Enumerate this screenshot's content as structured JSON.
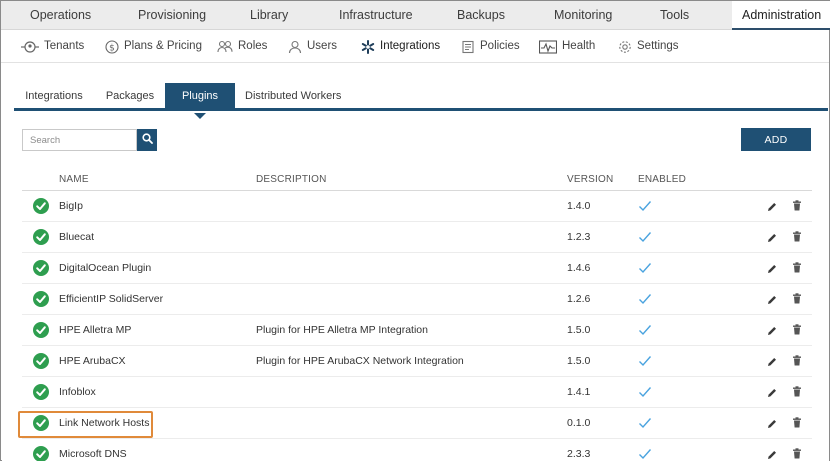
{
  "topnav": {
    "items": [
      {
        "label": "Operations"
      },
      {
        "label": "Provisioning"
      },
      {
        "label": "Library"
      },
      {
        "label": "Infrastructure"
      },
      {
        "label": "Backups"
      },
      {
        "label": "Monitoring"
      },
      {
        "label": "Tools"
      },
      {
        "label": "Administration",
        "active": true
      }
    ]
  },
  "subnav": {
    "items": [
      {
        "label": "Tenants",
        "icon": "tenants-icon"
      },
      {
        "label": "Plans & Pricing",
        "icon": "dollar-icon"
      },
      {
        "label": "Roles",
        "icon": "roles-icon"
      },
      {
        "label": "Users",
        "icon": "user-icon"
      },
      {
        "label": "Integrations",
        "icon": "integrations-icon",
        "active": true
      },
      {
        "label": "Policies",
        "icon": "policies-icon"
      },
      {
        "label": "Health",
        "icon": "health-icon"
      },
      {
        "label": "Settings",
        "icon": "gear-icon"
      }
    ]
  },
  "tabs": [
    {
      "label": "Integrations"
    },
    {
      "label": "Packages"
    },
    {
      "label": "Plugins",
      "active": true
    },
    {
      "label": "Distributed Workers"
    }
  ],
  "search": {
    "placeholder": "Search",
    "value": ""
  },
  "add_label": "ADD",
  "table": {
    "headers": {
      "name": "NAME",
      "description": "DESCRIPTION",
      "version": "VERSION",
      "enabled": "ENABLED"
    },
    "rows": [
      {
        "name": "BigIp",
        "description": "",
        "version": "1.4.0",
        "enabled": true
      },
      {
        "name": "Bluecat",
        "description": "",
        "version": "1.2.3",
        "enabled": true
      },
      {
        "name": "DigitalOcean Plugin",
        "description": "",
        "version": "1.4.6",
        "enabled": true
      },
      {
        "name": "EfficientIP SolidServer",
        "description": "",
        "version": "1.2.6",
        "enabled": true
      },
      {
        "name": "HPE Alletra MP",
        "description": "Plugin for HPE Alletra MP Integration",
        "version": "1.5.0",
        "enabled": true
      },
      {
        "name": "HPE ArubaCX",
        "description": "Plugin for HPE ArubaCX Network Integration",
        "version": "1.5.0",
        "enabled": true
      },
      {
        "name": "Infoblox",
        "description": "",
        "version": "1.4.1",
        "enabled": true
      },
      {
        "name": "Link Network Hosts",
        "description": "",
        "version": "0.1.0",
        "enabled": true,
        "highlighted": true
      },
      {
        "name": "Microsoft DNS",
        "description": "",
        "version": "2.3.3",
        "enabled": true
      }
    ]
  },
  "colors": {
    "accent": "#1f5074",
    "status_green": "#2e9e4f",
    "check_blue": "#4aa3df",
    "highlight_orange": "#e08a3a"
  }
}
